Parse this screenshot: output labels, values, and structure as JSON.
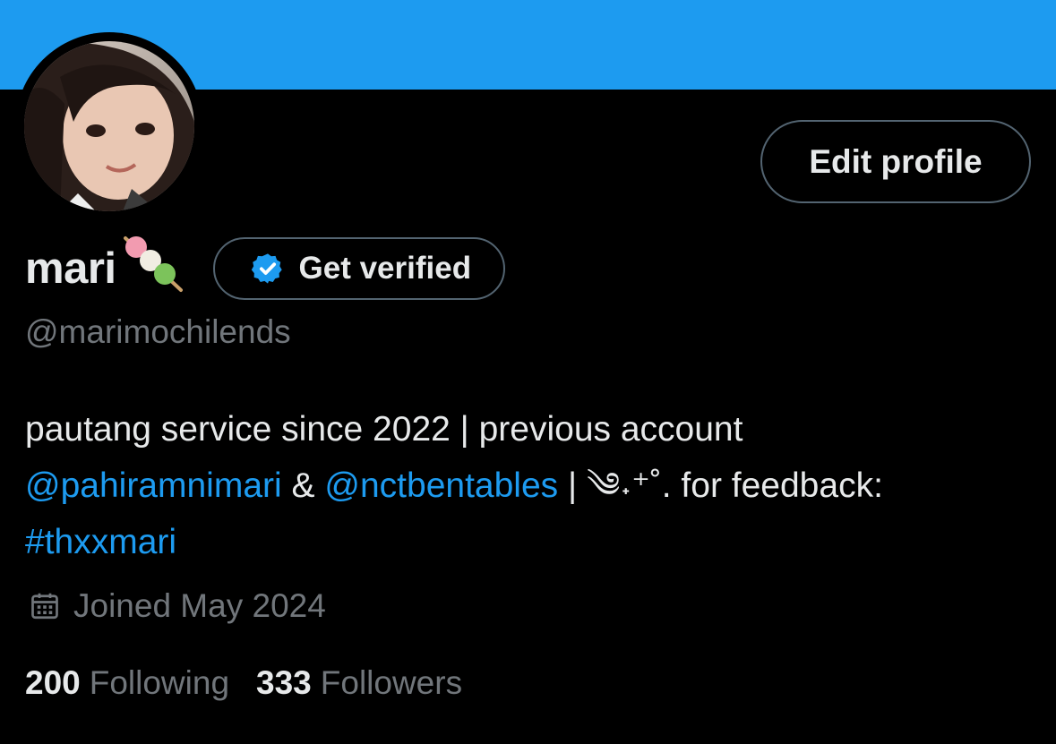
{
  "profile": {
    "display_name": "mari",
    "handle": "@marimochilends",
    "edit_profile_label": "Edit profile",
    "get_verified_label": "Get verified",
    "bio": {
      "line1": "pautang service since 2022 | previous account",
      "mention1": "@pahiramnimari",
      "amp": "&",
      "mention2": "@nctbentables",
      "after_mentions": " | ༄˖⁺˚. for feedback:",
      "hashtag": "#thxxmari"
    },
    "joined": "Joined May 2024",
    "stats": {
      "following_count": "200",
      "following_label": "Following",
      "followers_count": "333",
      "followers_label": "Followers"
    }
  },
  "colors": {
    "banner": "#1d9bf0",
    "background": "#000000",
    "primary_text": "#e7e9ea",
    "secondary_text": "#71767b",
    "link": "#1d9bf0",
    "border": "#536471"
  },
  "icons": [
    "dango-icon",
    "verified-check-icon",
    "calendar-icon"
  ]
}
